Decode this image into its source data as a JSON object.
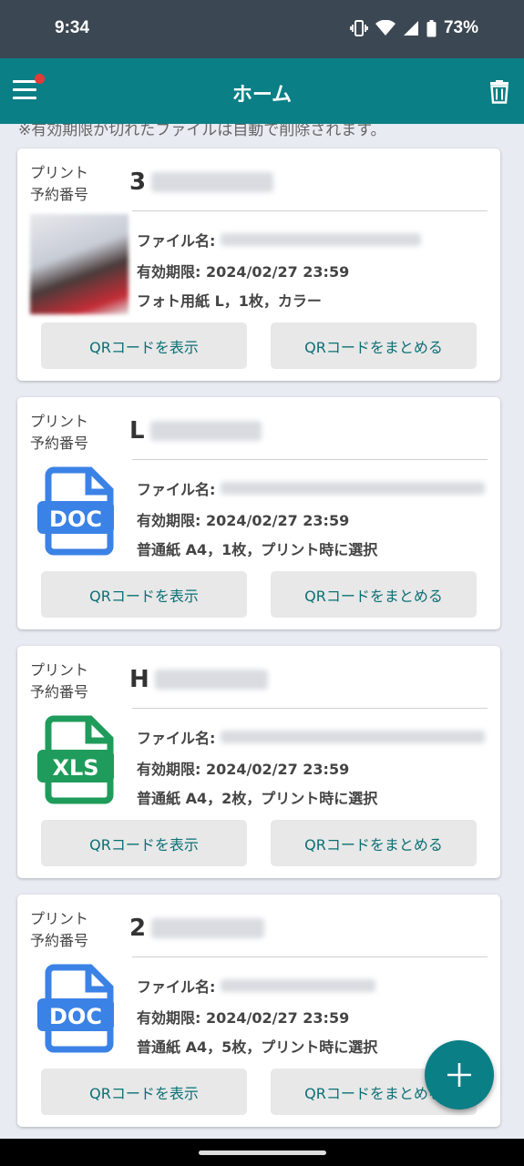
{
  "status": {
    "time": "9:34",
    "battery": "73%"
  },
  "appbar": {
    "title": "ホーム"
  },
  "notice": "※有効期限が切れたファイルは自動で削除されます。",
  "label_line1": "プリント",
  "label_line2": "予約番号",
  "filename_label": "ファイル名:",
  "button_show": "QRコードを表示",
  "button_combine": "QRコードをまとめる",
  "cards": [
    {
      "code_prefix": "3",
      "type": "photo",
      "expiry": "有効期限: 2024/02/27 23:59",
      "spec": "フォト用紙 L，1枚，カラー"
    },
    {
      "code_prefix": "L",
      "type": "doc",
      "icon_text": "DOC",
      "icon_color": "#3b82e6",
      "expiry": "有効期限: 2024/02/27 23:59",
      "spec": "普通紙 A4，1枚，プリント時に選択"
    },
    {
      "code_prefix": "H",
      "type": "xls",
      "icon_text": "XLS",
      "icon_color": "#1f9c5b",
      "expiry": "有効期限: 2024/02/27 23:59",
      "spec": "普通紙 A4，2枚，プリント時に選択"
    },
    {
      "code_prefix": "2",
      "type": "doc",
      "icon_text": "DOC",
      "icon_color": "#3b82e6",
      "expiry": "有効期限: 2024/02/27 23:59",
      "spec": "普通紙 A4，5枚，プリント時に選択"
    }
  ]
}
